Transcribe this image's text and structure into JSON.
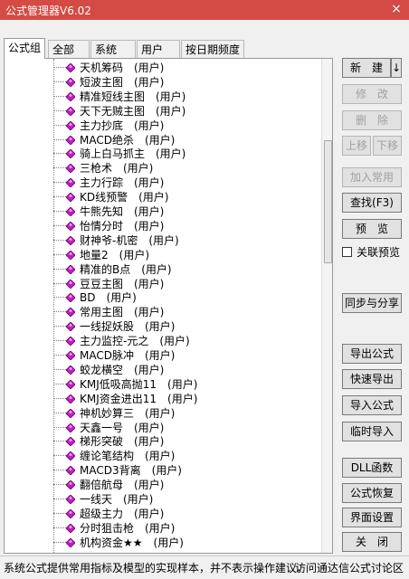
{
  "window": {
    "title": "公式管理器V6.02",
    "close": "×"
  },
  "tabs": [
    "公式组",
    "全部",
    "系统",
    "用户",
    "按日期频度"
  ],
  "tree_items": [
    "天机筹码　(用户)",
    "短波主图　(用户)",
    "精准短线主图　(用户)",
    "天下无贼主图　(用户)",
    "主力抄底　(用户)",
    "MACD绝杀　(用户)",
    "骑上白马抓主　(用户)",
    "三枪术　(用户)",
    "主力行踪　(用户)",
    "KD线预警　(用户)",
    "牛熊先知　(用户)",
    "怡情分时　(用户)",
    "财神爷-机密　(用户)",
    "地量2　(用户)",
    "精准的B点　(用户)",
    "豆豆主图　(用户)",
    "BD　(用户)",
    "常用主图　(用户)",
    "一线捉妖股　(用户)",
    "主力监控-元之　(用户)",
    "MACD脉冲　(用户)",
    "蛟龙横空　(用户)",
    "KMJ低吸高抛11　(用户)",
    "KMJ资金进出11　(用户)",
    "神机妙算三　(用户)",
    "天鑫一号　(用户)",
    "梯形突破　(用户)",
    "缠论笔结构　(用户)",
    "MACD3背离　(用户)",
    "翻倍航母　(用户)",
    "一线天　(用户)",
    "超级主力　(用户)",
    "分时狙击枪　(用户)",
    "机构资金★★　(用户)"
  ],
  "buttons": {
    "new": "新　建",
    "new_arrow": "↓",
    "modify": "修　改",
    "delete": "删　除",
    "move_up": "上移",
    "move_down": "下移",
    "add_common": "加入常用",
    "find": "查找(F3)",
    "preview": "预　览",
    "linked_preview": "关联预览",
    "sync_share": "同步与分享",
    "export": "导出公式",
    "quick_export": "快速导出",
    "import": "导入公式",
    "temp_import": "临时导入",
    "dll": "DLL函数",
    "restore": "公式恢复",
    "ui_settings": "界面设置",
    "close": "关　闭"
  },
  "status": {
    "message": "系统公式提供常用指标及模型的实现样本，并不表示操作建议。",
    "link": "访问通达信公式讨论区"
  },
  "colors": {
    "titlebar": "#d44a44",
    "gem": "#c020c0"
  }
}
